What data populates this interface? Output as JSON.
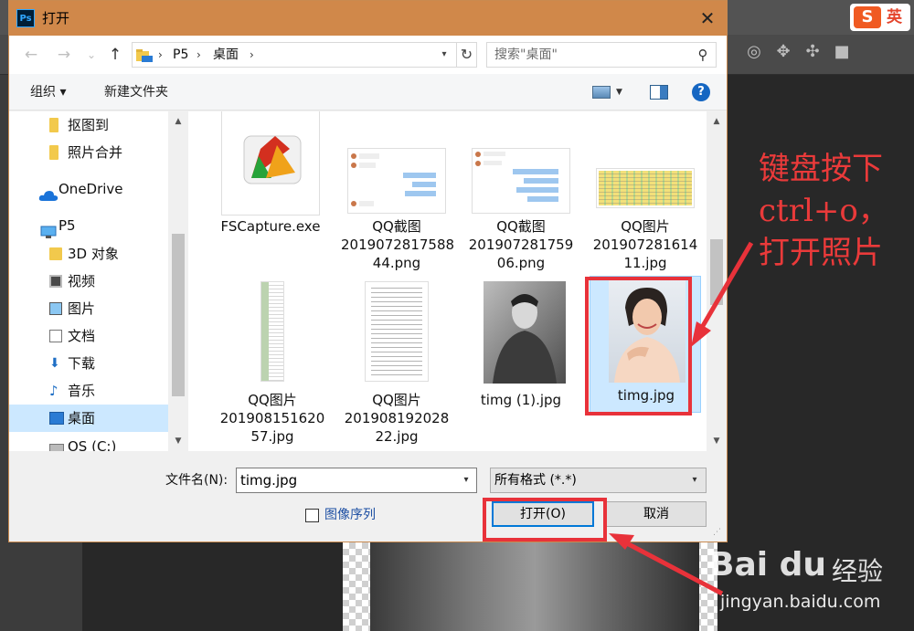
{
  "dialog": {
    "title": "打开",
    "app_badge": "Ps",
    "close_glyph": "✕"
  },
  "nav": {
    "back_glyph": "←",
    "forward_glyph": "→",
    "recent_glyph": "⌄",
    "up_glyph": "↑",
    "breadcrumb": [
      "P5",
      "桌面"
    ],
    "search_placeholder": "搜索\"桌面\""
  },
  "toolbar": {
    "organize_label": "组织 ▾",
    "new_folder_label": "新建文件夹",
    "help_glyph": "?"
  },
  "sidebar": {
    "items": [
      {
        "label": "抠图到",
        "icon": "folder-icon"
      },
      {
        "label": "照片合并",
        "icon": "folder-icon"
      },
      {
        "label": "OneDrive",
        "icon": "cloud-icon"
      },
      {
        "label": "P5",
        "icon": "computer-icon"
      },
      {
        "label": "3D 对象",
        "icon": "3d-objects-icon"
      },
      {
        "label": "视频",
        "icon": "video-icon"
      },
      {
        "label": "图片",
        "icon": "pictures-icon"
      },
      {
        "label": "文档",
        "icon": "documents-icon"
      },
      {
        "label": "下载",
        "icon": "downloads-icon"
      },
      {
        "label": "音乐",
        "icon": "music-icon"
      },
      {
        "label": "桌面",
        "icon": "desktop-icon",
        "selected": true
      },
      {
        "label": "OS (C:)",
        "icon": "drive-icon"
      }
    ]
  },
  "files": [
    {
      "name": "FSCapture.exe",
      "kind": "app"
    },
    {
      "name": "QQ截图\n2019072817588\n44.png",
      "kind": "chat"
    },
    {
      "name": "QQ截图\n201907281759\n06.png",
      "kind": "chat"
    },
    {
      "name": "QQ图片\n201907281614\n11.jpg",
      "kind": "sheet"
    },
    {
      "name": "QQ图片\n201908151620\n57.jpg",
      "kind": "column"
    },
    {
      "name": "QQ图片\n201908192028\n22.jpg",
      "kind": "doc"
    },
    {
      "name": "timg (1).jpg",
      "kind": "photo-man"
    },
    {
      "name": "timg.jpg",
      "kind": "photo-woman",
      "selected": true
    }
  ],
  "bottom": {
    "filename_label": "文件名(N):",
    "filename_value": "timg.jpg",
    "format_value": "所有格式 (*.*)",
    "image_sequence_label": "图像序列",
    "open_label": "打开(O)",
    "cancel_label": "取消"
  },
  "annotation": {
    "text": "键盘按下\nctrl+o，\n打开照片",
    "color": "#ea3a3a"
  },
  "watermark": {
    "logo": "Bai du",
    "brand": "经验",
    "url": "jingyan.baidu.com"
  },
  "ime": {
    "logo": "S",
    "mode": "英"
  }
}
